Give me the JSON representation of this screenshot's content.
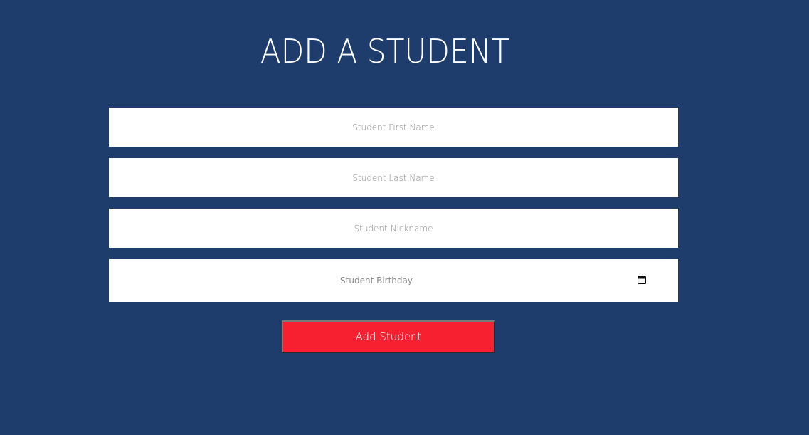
{
  "page": {
    "title": "ADD A STUDENT"
  },
  "form": {
    "first_name": {
      "value": "",
      "placeholder": "Student First Name"
    },
    "last_name": {
      "value": "",
      "placeholder": "Student Last Name"
    },
    "nickname": {
      "value": "",
      "placeholder": "Student Nickname"
    },
    "birthday": {
      "label": "Student Birthday",
      "icon": "calendar-icon"
    },
    "submit_label": "Add Student"
  },
  "colors": {
    "background": "#1e3d6c",
    "field_background": "#ffffff",
    "button": "#f62030",
    "title_text": "#ffffff"
  }
}
